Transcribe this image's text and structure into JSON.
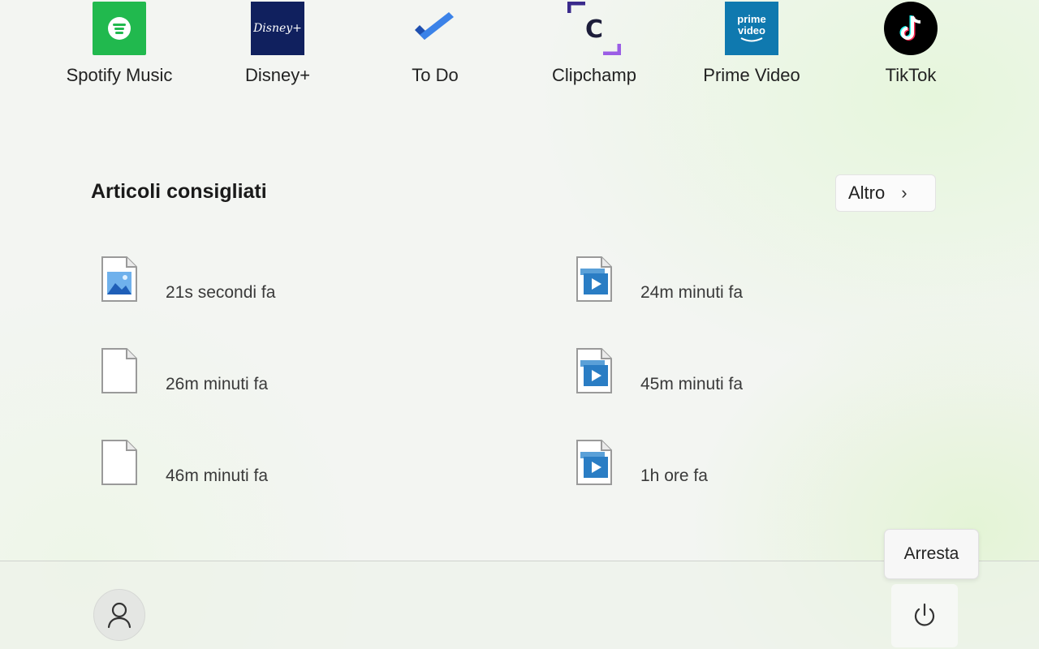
{
  "pinned_apps": [
    {
      "label": "Spotify Music",
      "icon": "spotify-icon"
    },
    {
      "label": "Disney+",
      "icon": "disney-plus-icon",
      "tile_text": "Disney+"
    },
    {
      "label": "To Do",
      "icon": "todo-check-icon"
    },
    {
      "label": "Clipchamp",
      "icon": "clipchamp-icon",
      "tile_text": "C"
    },
    {
      "label": "Prime Video",
      "icon": "prime-video-icon",
      "tile_text_1": "prime",
      "tile_text_2": "video"
    },
    {
      "label": "TikTok",
      "icon": "tiktok-icon"
    }
  ],
  "recommended": {
    "title": "Articoli consigliati",
    "more_label": "Altro",
    "items": [
      {
        "time": "21s secondi fa",
        "icon": "image-file-icon"
      },
      {
        "time": "24m minuti fa",
        "icon": "video-file-icon"
      },
      {
        "time": "26m minuti fa",
        "icon": "blank-file-icon"
      },
      {
        "time": "45m minuti fa",
        "icon": "video-file-icon"
      },
      {
        "time": "46m minuti fa",
        "icon": "blank-file-icon"
      },
      {
        "time": "1h ore fa",
        "icon": "video-file-icon"
      }
    ]
  },
  "footer": {
    "user_icon": "user-icon",
    "power_icon": "power-icon",
    "power_tooltip": "Arresta"
  },
  "colors": {
    "spotify": "#21b94e",
    "disney": "#10205e",
    "todo_blue": "#2f6fd6",
    "prime": "#0f79af",
    "tiktok": "#000000",
    "clipchamp_purple": "#7c4dd8"
  }
}
